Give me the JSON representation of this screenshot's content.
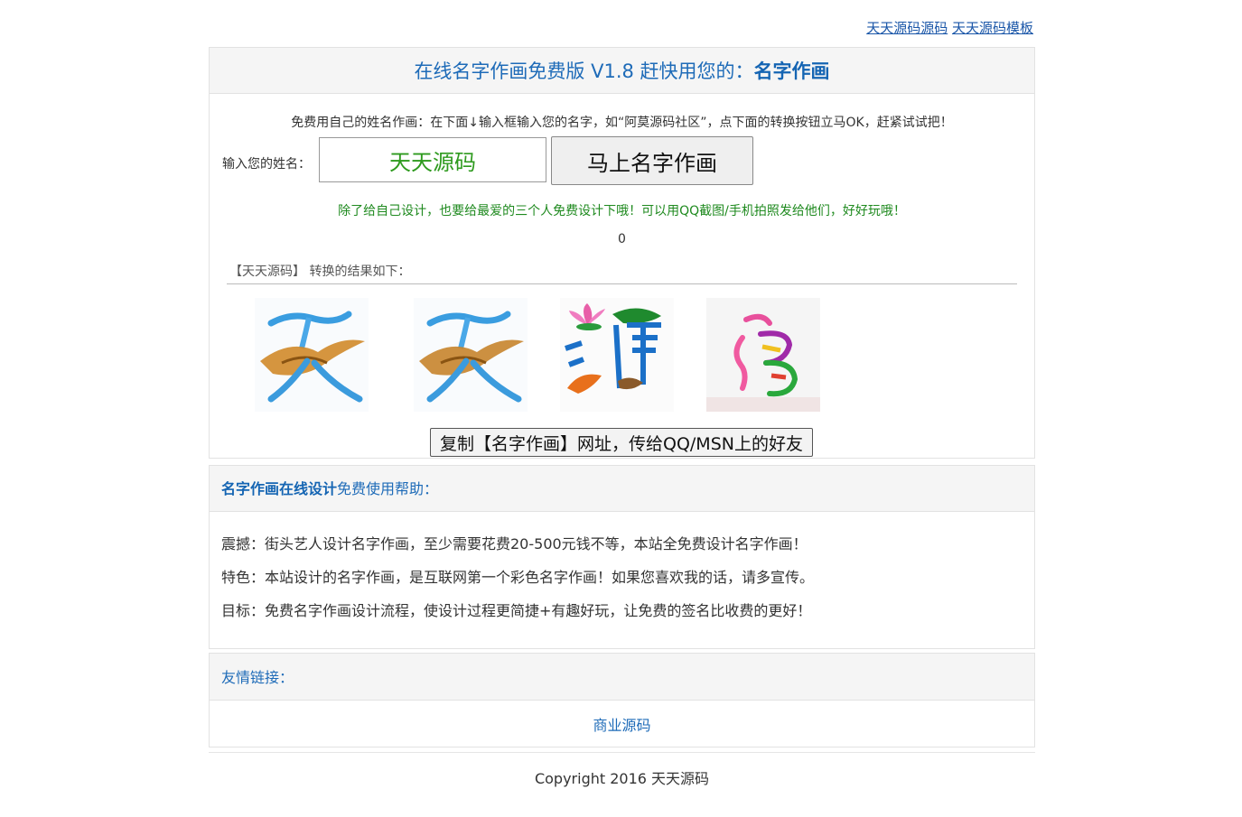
{
  "toplinks": [
    "天天源码源码",
    "天天源码模板"
  ],
  "main": {
    "title_prefix": "在线名字作画免费版 V1.8 赶快用您的：",
    "title_strong": "名字作画",
    "intro": "免费用自己的姓名作画：在下面↓输入框输入您的名字，如“阿莫源码社区”，点下面的转换按钮立马OK，赶紧试试把！",
    "name_label": "输入您的姓名：",
    "name_value": "天天源码",
    "convert_button": "马上名字作画",
    "hint": "除了给自己设计，也要给最爱的三个人免费设计下哦！可以用QQ截图/手机拍照发给他们，好好玩哦！",
    "count": "0",
    "result_label": "【天天源码】 转换的结果如下：",
    "tiles": [
      "天",
      "天",
      "源",
      "码"
    ],
    "copy_button": "复制【名字作画】网址，传给QQ/MSN上的好友"
  },
  "help": {
    "title_strong": "名字作画在线设计",
    "title_rest": "免费使用帮助：",
    "lines": [
      "震撼：街头艺人设计名字作画，至少需要花费20-500元钱不等，本站全免费设计名字作画！",
      "特色：本站设计的名字作画，是互联网第一个彩色名字作画！如果您喜欢我的话，请多宣传。",
      "目标：免费名字作画设计流程，使设计过程更简捷+有趣好玩，让免费的签名比收费的更好！"
    ]
  },
  "friends": {
    "title": "友情链接：",
    "links": [
      "商业源码"
    ]
  },
  "footer": {
    "copyright": "Copyright 2016 天天源码"
  }
}
